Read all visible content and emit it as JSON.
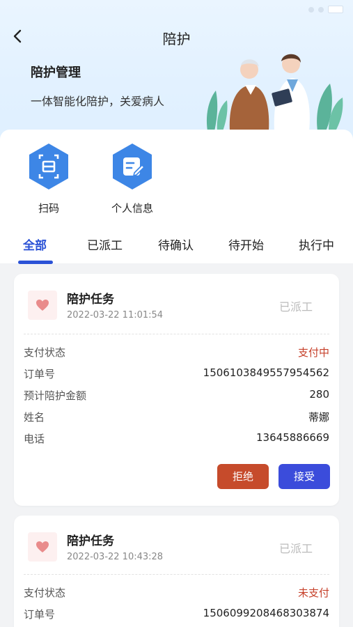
{
  "nav": {
    "title": "陪护"
  },
  "hero": {
    "title": "陪护管理",
    "subtitle": "一体智能化陪护，关爱病人"
  },
  "actions": [
    {
      "label": "扫码",
      "icon": "scan-icon"
    },
    {
      "label": "个人信息",
      "icon": "profile-icon"
    }
  ],
  "tabs": [
    {
      "label": "全部",
      "active": true
    },
    {
      "label": "已派工",
      "active": false
    },
    {
      "label": "待确认",
      "active": false
    },
    {
      "label": "待开始",
      "active": false
    },
    {
      "label": "执行中",
      "active": false
    }
  ],
  "colors": {
    "accent": "#2b52d6",
    "reject": "#c64b2b",
    "accept": "#3b4cdb",
    "red_text": "#c6402a"
  },
  "cards": [
    {
      "title": "陪护任务",
      "time": "2022-03-22 11:01:54",
      "status": "已派工",
      "fields": [
        {
          "key": "支付状态",
          "value": "支付中"
        },
        {
          "key": "订单号",
          "value": "1506103849557954562"
        },
        {
          "key": "预计陪护金额",
          "value": "280"
        },
        {
          "key": "姓名",
          "value": "蒂娜"
        },
        {
          "key": "电话",
          "value": "13645886669"
        }
      ],
      "reject_label": "拒绝",
      "accept_label": "接受"
    },
    {
      "title": "陪护任务",
      "time": "2022-03-22 10:43:28",
      "status": "已派工",
      "fields": [
        {
          "key": "支付状态",
          "value": "未支付"
        },
        {
          "key": "订单号",
          "value": "1506099208468303874"
        }
      ]
    }
  ]
}
